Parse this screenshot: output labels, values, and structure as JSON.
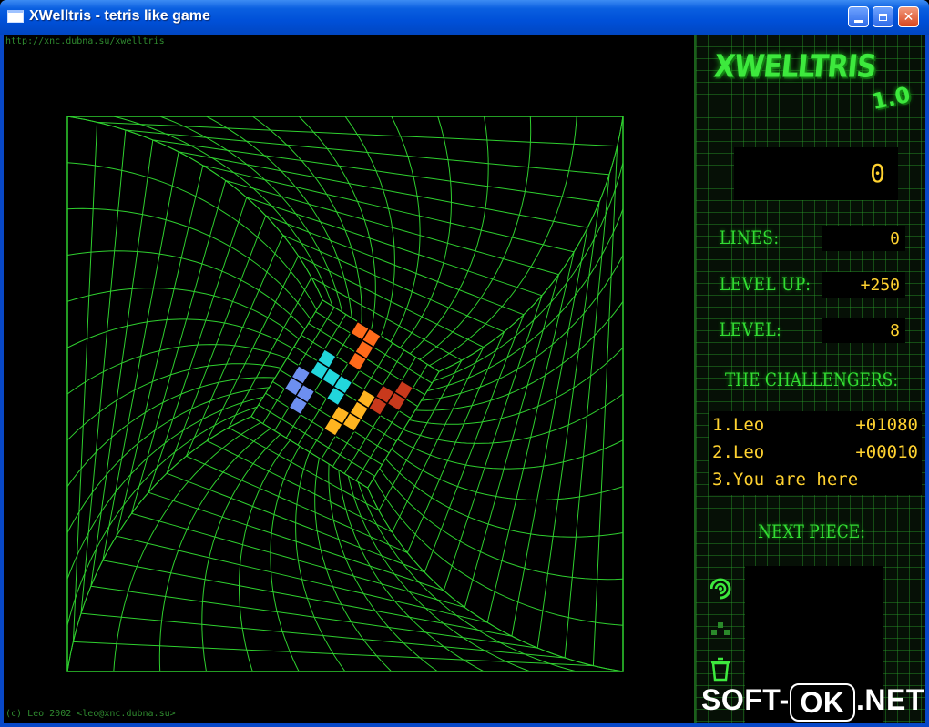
{
  "window": {
    "title": "XWelltris - tetris like game",
    "controls": {
      "minimize": "minimize",
      "maximize": "maximize",
      "close": "✕"
    }
  },
  "game": {
    "url": "http://xnc.dubna.su/xwelltris",
    "copyright": "(c) Leo 2002 <leo@xnc.dubna.su>"
  },
  "panel": {
    "logo": "XWELLTRIS",
    "version": "1.0",
    "score": "0",
    "stats": [
      {
        "label": "LINES:",
        "value": "0"
      },
      {
        "label": "LEVEL UP:",
        "value": "+250"
      },
      {
        "label": "LEVEL:",
        "value": "8"
      }
    ],
    "challengers_title": "THE CHALLENGERS:",
    "highscores": [
      {
        "name": "1.Leo",
        "score": "+01080"
      },
      {
        "name": "2.Leo",
        "score": "+00010"
      },
      {
        "name": "3.You are here",
        "score": ""
      }
    ],
    "next_piece_title": "NEXT PIECE:",
    "icons": [
      "rotate-icon",
      "pieces-icon",
      "trash-icon"
    ]
  },
  "watermark": {
    "left": "SOFT-",
    "box": "OK",
    "right": ".NET"
  },
  "colors": {
    "grid": "#2fcf2f",
    "orange": "#ff6a1a",
    "red": "#c8391c",
    "cyan": "#22d6dc",
    "blue": "#6d8ff0",
    "yellow": "#ffb420",
    "score": "#ffd230"
  }
}
